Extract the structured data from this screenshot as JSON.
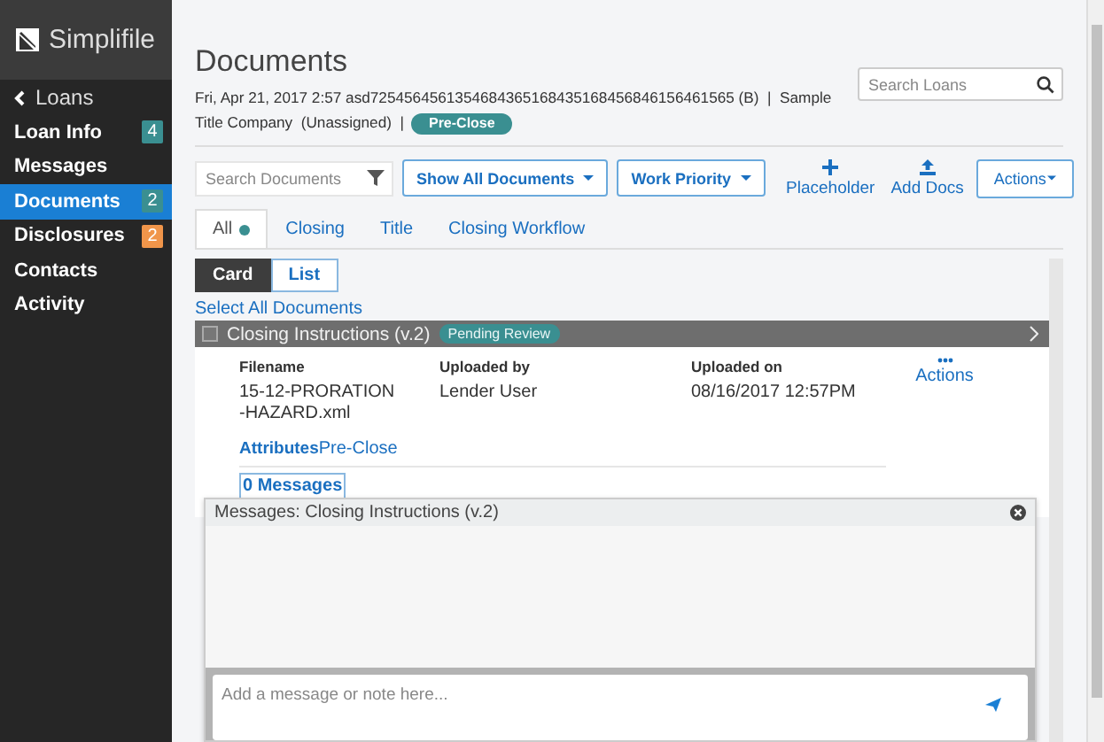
{
  "sidebar": {
    "logo": "Simplifile",
    "back": "Loans",
    "items": [
      {
        "label": "Loan Info",
        "badge": "4",
        "color": "#3a8f91",
        "selected": false
      },
      {
        "label": "Messages",
        "selected": false
      },
      {
        "label": "Documents",
        "badge": "2",
        "color": "#3a8f91",
        "selected": true
      },
      {
        "label": "Disclosures",
        "badge": "2",
        "color": "#f0954a",
        "selected": false
      },
      {
        "label": "Contacts",
        "selected": false
      },
      {
        "label": "Activity",
        "selected": false
      }
    ]
  },
  "header": {
    "title": "Documents",
    "info_lines": [
      "Fri, Apr 21, 2017 2:57 asd7254564561354684365168435168456846156461565 (B)  |  Sample",
      "Title Company  (Unassigned)  |"
    ],
    "status": "Pre-Close",
    "search": {
      "placeholder": "Search Loans"
    }
  },
  "toolbar": {
    "search": {
      "placeholder": "Search Documents"
    },
    "dropdowns": [
      "Show All Documents",
      "Work Priority"
    ],
    "actions": [
      {
        "label": "Placeholder",
        "kind": "plus"
      },
      {
        "label": "Add Docs",
        "kind": "upload"
      }
    ],
    "menu": "Actions"
  },
  "tabs": [
    {
      "label": "All",
      "selected": true,
      "dot": true
    },
    {
      "label": "Closing",
      "selected": false,
      "dot": false
    },
    {
      "label": "Title",
      "selected": false,
      "dot": false
    },
    {
      "label": "Closing Workflow",
      "selected": false,
      "dot": false
    }
  ],
  "view_toggle": [
    {
      "label": "Card",
      "selected": true
    },
    {
      "label": "List",
      "selected": false
    }
  ],
  "select_all": "Select All Documents",
  "document": {
    "title": "Closing Instructions (v.2)",
    "checked": false,
    "status": "Pending Review",
    "columns": [
      {
        "heading": "Filename",
        "value": "15-12-PRORATION-HAZARD.xml"
      },
      {
        "heading": "Uploaded by",
        "value": "Lender User"
      },
      {
        "heading": "Uploaded on",
        "value": "08/16/2017 12:57PM"
      }
    ],
    "actions": "Actions",
    "attributes_label": "Attributes",
    "attributes_value": "Pre-Close",
    "messages": "0 Messages"
  },
  "messages_panel": {
    "title": "Messages: Closing Instructions (v.2)",
    "input": {
      "placeholder": "Add a message or note here..."
    }
  }
}
